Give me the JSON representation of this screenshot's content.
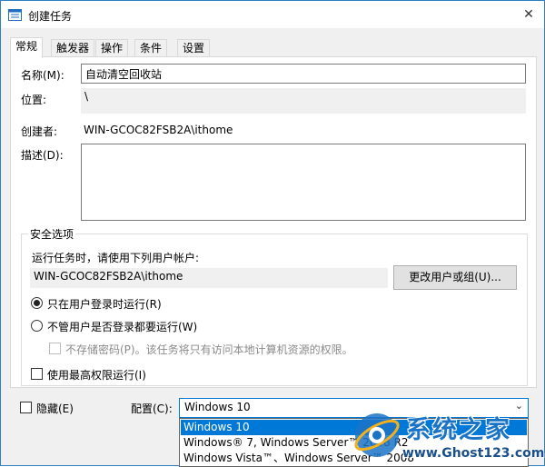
{
  "window": {
    "title": "创建任务",
    "close": "✕"
  },
  "tabs": [
    {
      "label": "常规",
      "active": true
    },
    {
      "label": "触发器",
      "active": false
    },
    {
      "label": "操作",
      "active": false
    },
    {
      "label": "条件",
      "active": false
    },
    {
      "label": "设置",
      "active": false
    }
  ],
  "general": {
    "name_label": "名称(M):",
    "name_value": "自动清空回收站",
    "location_label": "位置:",
    "location_value": "\\",
    "author_label": "创建者:",
    "author_value": "WIN-GCOC82FSB2A\\ithome",
    "description_label": "描述(D):",
    "description_value": ""
  },
  "security": {
    "group_title": "安全选项",
    "run_as_label": "运行任务时，请使用下列用户帐户:",
    "account_value": "WIN-GCOC82FSB2A\\ithome",
    "change_user_button": "更改用户或组(U)...",
    "radio_logged_on": "只在用户登录时运行(R)",
    "radio_logged_on_selected": true,
    "radio_whether": "不管用户是否登录都要运行(W)",
    "no_store_password": "不存储密码(P)。该任务将只有访问本地计算机资源的权限。",
    "highest_privileges": "使用最高权限运行(I)"
  },
  "bottom": {
    "hidden_label": "隐藏(E)",
    "configure_label": "配置(C):",
    "configure_value": "Windows 10",
    "options": [
      "Windows 10",
      "Windows® 7, Windows Server™ 2008 R2",
      "Windows Vista™、Windows Server™ 2008"
    ]
  },
  "watermark": {
    "name": "系统之家",
    "url": "www.Ghost123.com"
  },
  "colors": {
    "accent": "#0078d7",
    "title_icon": "#1f6ec0",
    "watermark_blue": "#1b73c6"
  }
}
